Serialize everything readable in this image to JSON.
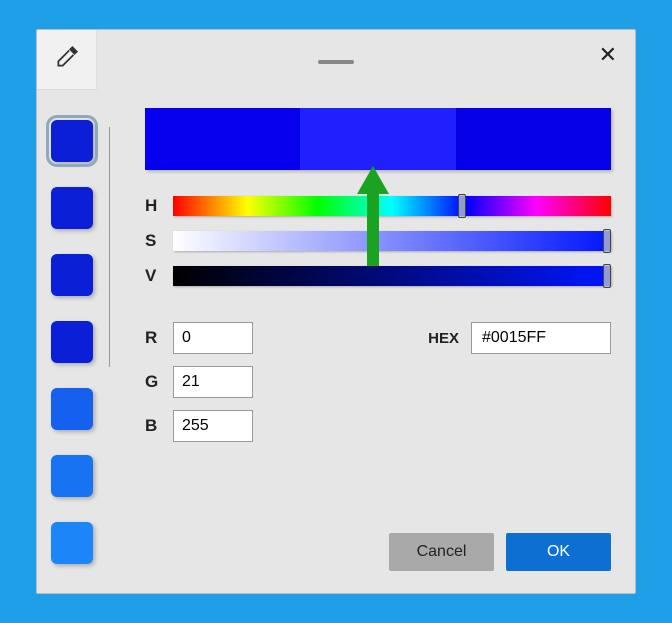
{
  "swatches": [
    "#0a1fd6",
    "#0a1fd6",
    "#0a1fd6",
    "#0a1fd6",
    "#1560ef",
    "#1873f3",
    "#1c85f8"
  ],
  "swatchSelected": 0,
  "preview": {
    "left": "#0700ee",
    "mid": "#2020ff",
    "right": "#0600e8"
  },
  "labels": {
    "h": "H",
    "s": "S",
    "v": "V",
    "r": "R",
    "g": "G",
    "b": "B",
    "hex": "HEX",
    "cancel": "Cancel",
    "ok": "OK"
  },
  "slider": {
    "hPos": 66,
    "sPos": 99,
    "vPos": 99
  },
  "rgb": {
    "r": "0",
    "g": "21",
    "b": "255"
  },
  "hex": "#0015FF",
  "arrowColor": "#1aa321"
}
